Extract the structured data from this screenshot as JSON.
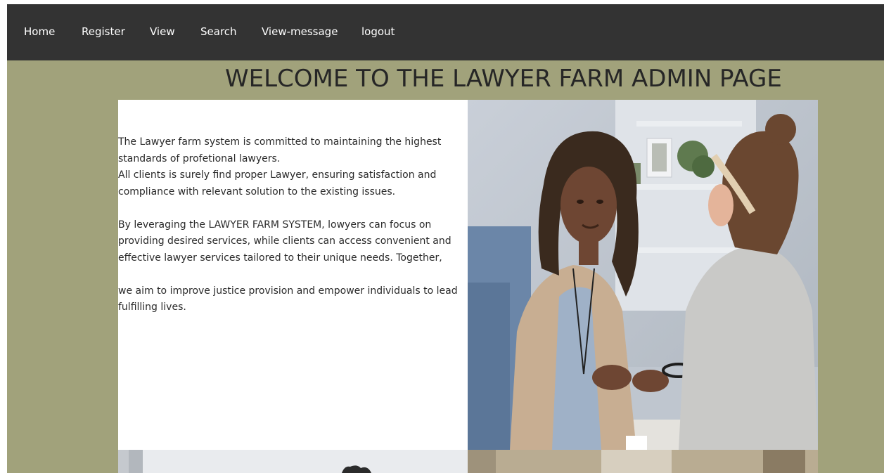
{
  "nav": {
    "items": [
      {
        "id": "home",
        "label": "Home"
      },
      {
        "id": "register",
        "label": "Register"
      },
      {
        "id": "view",
        "label": "View"
      },
      {
        "id": "search",
        "label": "Search"
      },
      {
        "id": "view-message",
        "label": "View-message"
      },
      {
        "id": "logout",
        "label": "logout"
      }
    ]
  },
  "page": {
    "title": "WELCOME TO THE LAWYER FARM ADMIN PAGE"
  },
  "intro": {
    "line1": "The Lawyer farm system is committed to maintaining the highest standards of profetional lawyers.",
    "line2": "All clients is surely find proper Lawyer, ensuring satisfaction and compliance with relevant solution to the existing issues.",
    "line3": "By leveraging the LAWYER FARM SYSTEM, lowyers can focus on providing desired services, while clients can access convenient and effective lawyer services tailored to their unique needs. Together,",
    "line4": "we aim to improve justice provision and empower individuals to lead fulfilling lives."
  },
  "colors": {
    "navbar": "#333333",
    "page_background": "#a1a27b",
    "panel": "#ffffff",
    "title_text": "#262626"
  }
}
